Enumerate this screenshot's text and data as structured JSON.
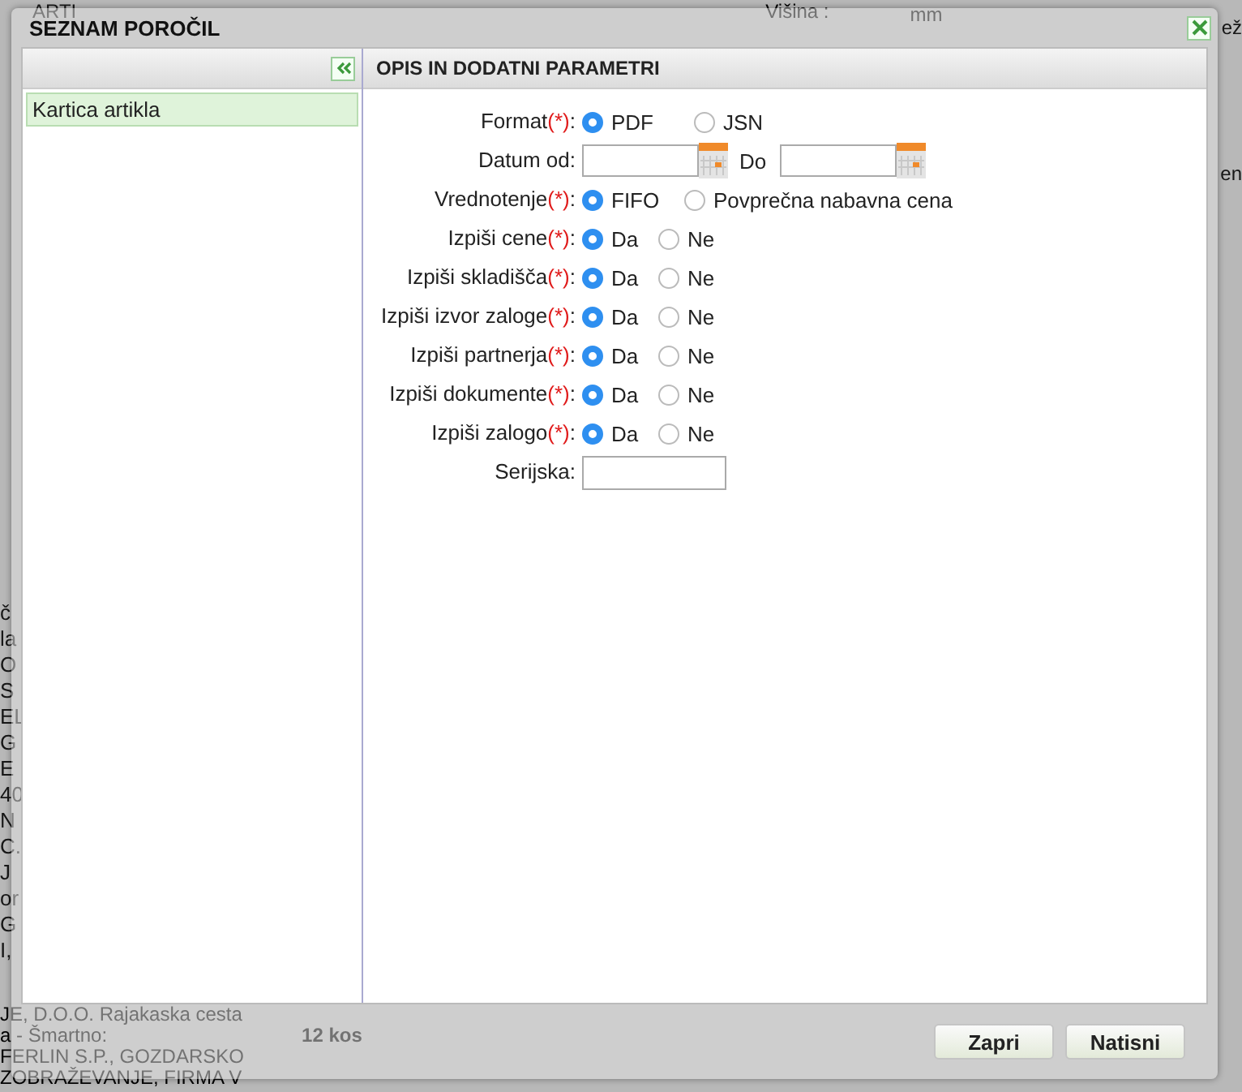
{
  "background": {
    "top_left": "ARTI",
    "height_label": "Višina :",
    "unit": "mm",
    "right_top": "ež",
    "right_mid": "en",
    "left_fragments": [
      "č",
      "la",
      "O",
      "S",
      "EL",
      "G",
      "E",
      "40",
      "N",
      "C.",
      "J",
      "or",
      "G",
      "I,"
    ],
    "bottom_lines": [
      "JE, D.O.O. Rajakaska cesta",
      "a - Šmartno:",
      "FERLIN S.P., GOZDARSKO",
      "ZOBRAŽEVANJE, FIRMA V"
    ],
    "quantity": "12 kos"
  },
  "dialog": {
    "title": "SEZNAM POROČIL",
    "sidebar": {
      "items": [
        {
          "label": "Kartica artikla",
          "selected": true
        }
      ]
    },
    "panel": {
      "title": "OPIS IN DODATNI PARAMETRI",
      "rows": [
        {
          "kind": "radio",
          "label": "Format",
          "required_mark": "(*)",
          "separator": ":",
          "options": [
            {
              "label": "PDF",
              "selected": true
            },
            {
              "label": "JSN",
              "selected": false
            }
          ]
        },
        {
          "kind": "date_range",
          "label": "Datum od:",
          "to_label": "Do"
        },
        {
          "kind": "radio",
          "label": "Vrednotenje",
          "required_mark": "(*)",
          "separator": ":",
          "options": [
            {
              "label": "FIFO",
              "selected": true
            },
            {
              "label": "Povprečna nabavna cena",
              "selected": false
            }
          ]
        },
        {
          "kind": "radio",
          "label": "Izpiši cene",
          "required_mark": "(*)",
          "separator": ":",
          "options": [
            {
              "label": "Da",
              "selected": true
            },
            {
              "label": "Ne",
              "selected": false
            }
          ]
        },
        {
          "kind": "radio",
          "label": "Izpiši skladišča",
          "required_mark": "(*)",
          "separator": ":",
          "options": [
            {
              "label": "Da",
              "selected": true
            },
            {
              "label": "Ne",
              "selected": false
            }
          ]
        },
        {
          "kind": "radio",
          "label": "Izpiši izvor zaloge",
          "required_mark": "(*)",
          "separator": ":",
          "options": [
            {
              "label": "Da",
              "selected": true
            },
            {
              "label": "Ne",
              "selected": false
            }
          ]
        },
        {
          "kind": "radio",
          "label": "Izpiši partnerja",
          "required_mark": "(*)",
          "separator": ":",
          "options": [
            {
              "label": "Da",
              "selected": true
            },
            {
              "label": "Ne",
              "selected": false
            }
          ]
        },
        {
          "kind": "radio",
          "label": "Izpiši dokumente",
          "required_mark": "(*)",
          "separator": ":",
          "options": [
            {
              "label": "Da",
              "selected": true
            },
            {
              "label": "Ne",
              "selected": false
            }
          ]
        },
        {
          "kind": "radio",
          "label": "Izpiši zalogo",
          "required_mark": "(*)",
          "separator": ":",
          "options": [
            {
              "label": "Da",
              "selected": true
            },
            {
              "label": "Ne",
              "selected": false
            }
          ]
        },
        {
          "kind": "text",
          "label": "Serijska",
          "separator": ":"
        }
      ]
    },
    "buttons": [
      "Zapri",
      "Natisni"
    ]
  }
}
